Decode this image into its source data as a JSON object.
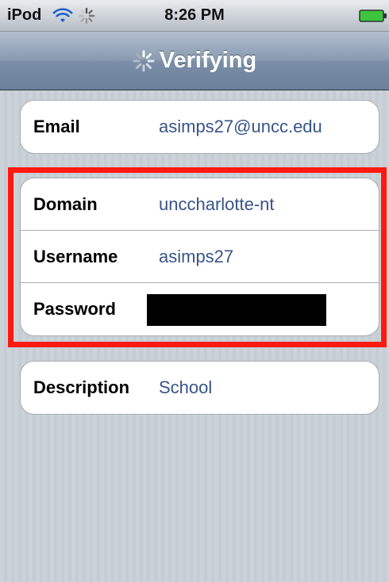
{
  "status_bar": {
    "carrier": "iPod",
    "time": "8:26 PM"
  },
  "nav_bar": {
    "title": "Verifying"
  },
  "account": {
    "email_label": "Email",
    "email_value": "asimps27@uncc.edu",
    "domain_label": "Domain",
    "domain_value": "unccharlotte-nt",
    "username_label": "Username",
    "username_value": "asimps27",
    "password_label": "Password",
    "description_label": "Description",
    "description_value": "School"
  },
  "colors": {
    "highlight": "#ff1a10",
    "value_text": "#385487"
  }
}
